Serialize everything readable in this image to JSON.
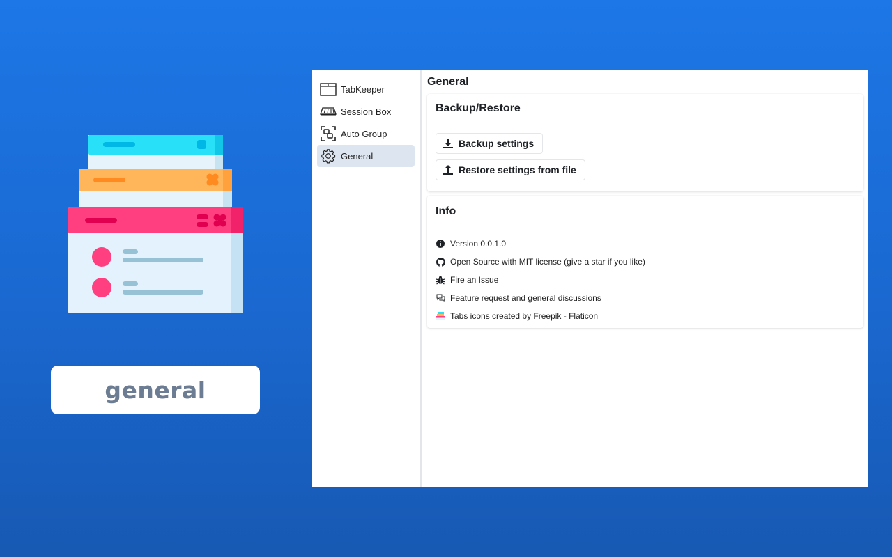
{
  "caption": "general",
  "sidebar": {
    "items": [
      {
        "label": "TabKeeper",
        "icon": "tab-outline-icon"
      },
      {
        "label": "Session Box",
        "icon": "box-icon"
      },
      {
        "label": "Auto Group",
        "icon": "group-icon"
      },
      {
        "label": "General",
        "icon": "gear-icon",
        "active": true
      }
    ]
  },
  "main": {
    "title": "General",
    "backup": {
      "title": "Backup/Restore",
      "backup_label": "Backup settings",
      "restore_label": "Restore settings from file"
    },
    "info": {
      "title": "Info",
      "items": [
        {
          "icon": "info-circle-icon",
          "text": "Version 0.0.1.0"
        },
        {
          "icon": "github-icon",
          "text": "Open Source with MIT license (give a star if you like)"
        },
        {
          "icon": "bug-icon",
          "text": "Fire an Issue"
        },
        {
          "icon": "chat-bubbles-icon",
          "text": "Feature request and general discussions"
        },
        {
          "icon": "tabs-logo-icon",
          "text": "Tabs icons created by Freepik - Flaticon"
        }
      ]
    }
  },
  "colors": {
    "background": "#1d77e6",
    "active_nav": "#dde6f0",
    "tab_cyan": "#28e1f9",
    "tab_orange": "#ffb55a",
    "tab_pink": "#ff3f7f"
  }
}
